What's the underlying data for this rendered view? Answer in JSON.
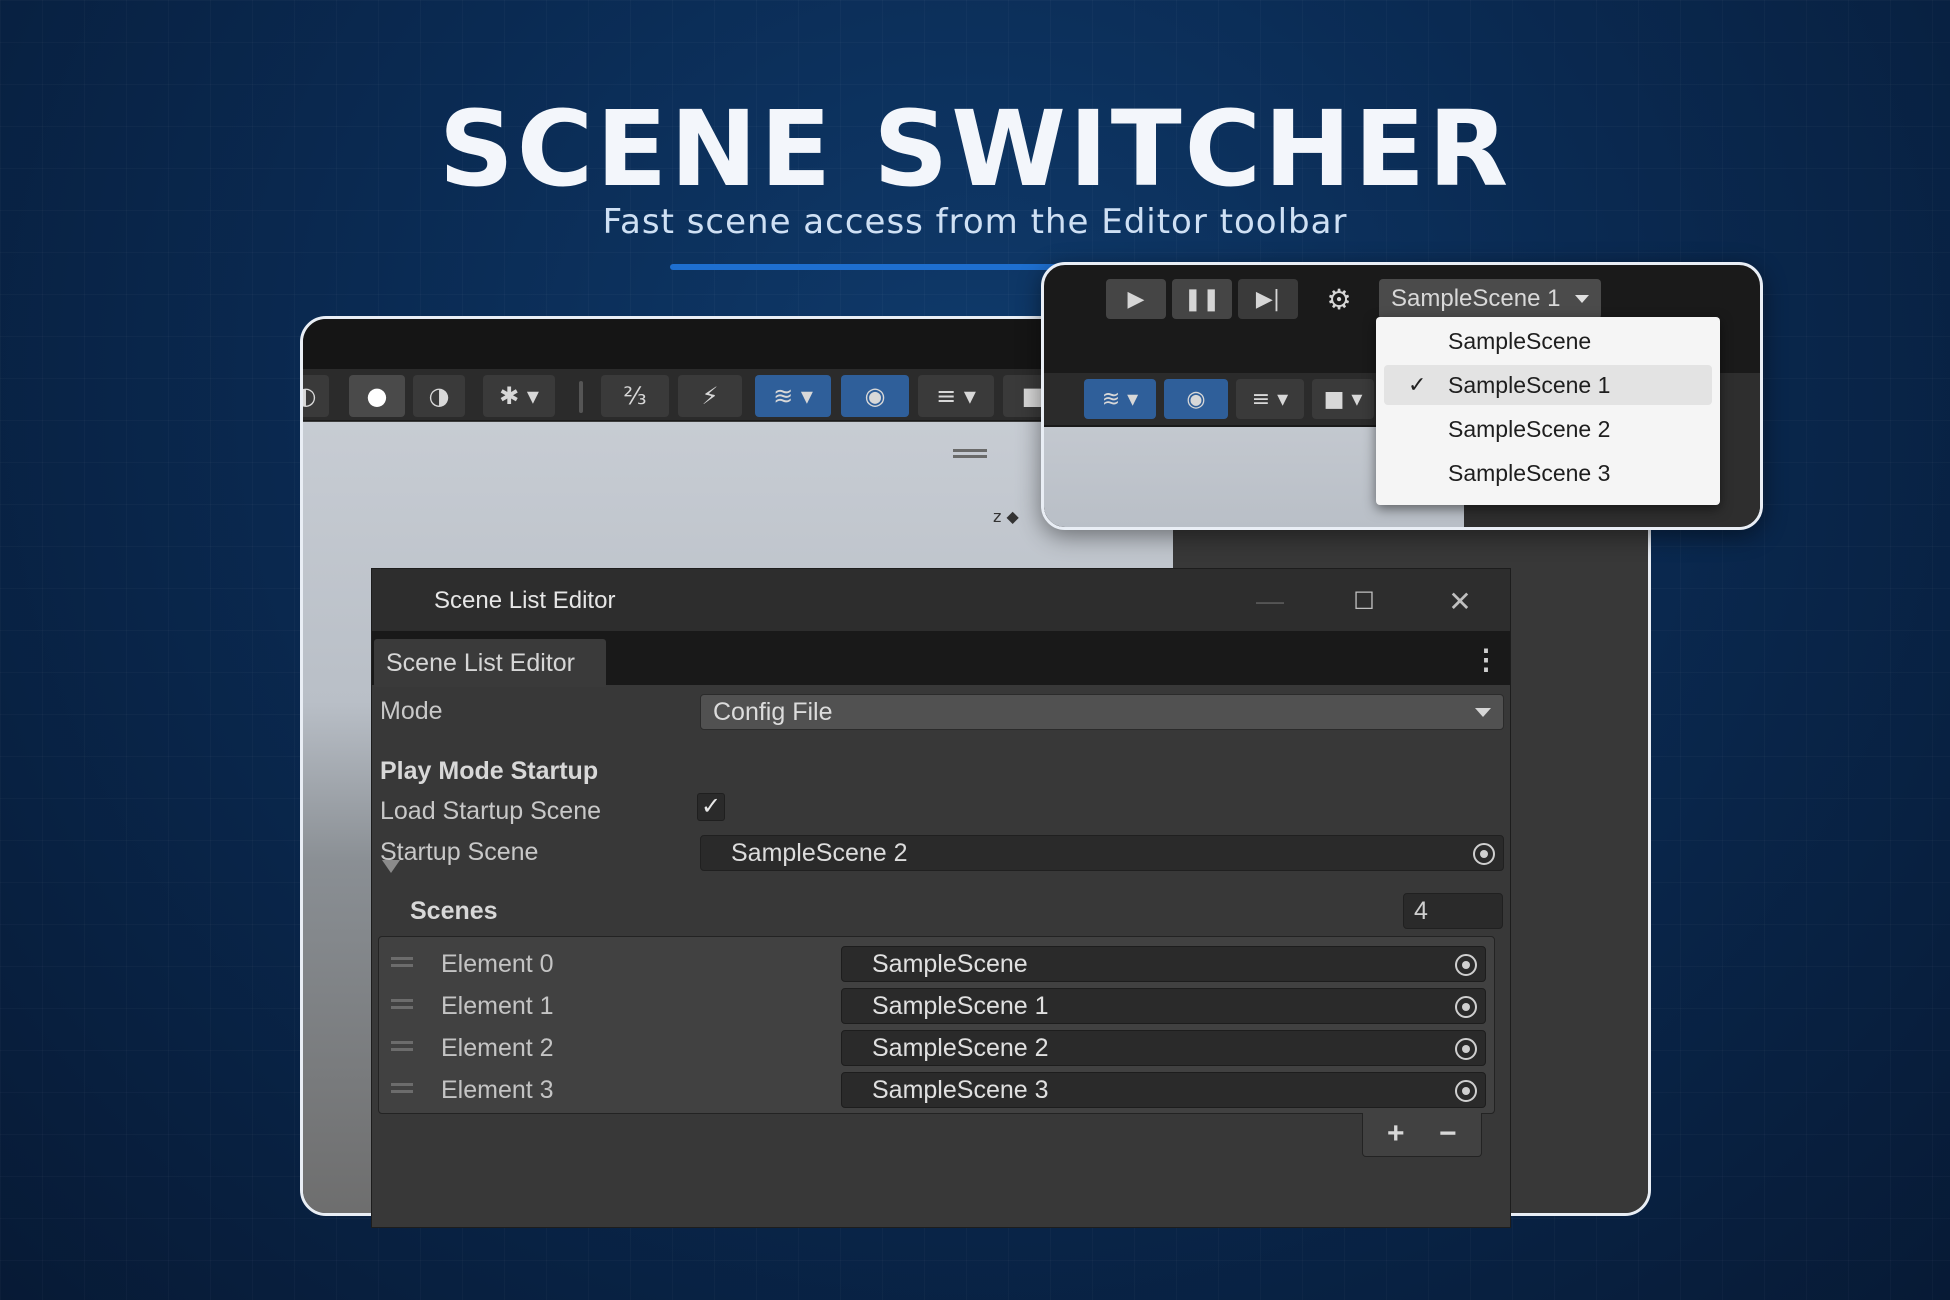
{
  "header": {
    "title": "SCENE SWITCHER",
    "subtitle": "Fast scene access from the Editor toolbar"
  },
  "editor_window": {
    "title": "Scene List Editor",
    "tab_label": "Scene List Editor",
    "mode_label": "Mode",
    "mode_value": "Config File",
    "section_play_mode": "Play Mode Startup",
    "load_startup_label": "Load Startup Scene",
    "load_startup_checked": "✓",
    "startup_scene_label": "Startup Scene",
    "startup_scene_value": "SampleScene 2",
    "scenes_label": "Scenes",
    "scenes_count": "4",
    "elements": [
      {
        "label": "Element 0",
        "value": "SampleScene"
      },
      {
        "label": "Element 1",
        "value": "SampleScene 1"
      },
      {
        "label": "Element 2",
        "value": "SampleScene 2"
      },
      {
        "label": "Element 3",
        "value": "SampleScene 3"
      }
    ],
    "add_label": "+",
    "remove_label": "−"
  },
  "toolbar_zoom": {
    "scene_button_label": "SampleScene 1",
    "menu_items": [
      "SampleScene",
      "SampleScene 1",
      "SampleScene 2",
      "SampleScene 3"
    ],
    "selected_index": 1,
    "check_glyph": "✓"
  },
  "icons": [
    "play-icon",
    "pause-icon",
    "step-icon",
    "gear-icon",
    "eye-icon",
    "layers-icon",
    "object-picker-icon",
    "kebab-menu-icon",
    "maximize-icon",
    "close-icon"
  ],
  "colors": {
    "accent": "#1e6fd0",
    "background": "#0a2a52",
    "editor_bg": "#383838"
  }
}
